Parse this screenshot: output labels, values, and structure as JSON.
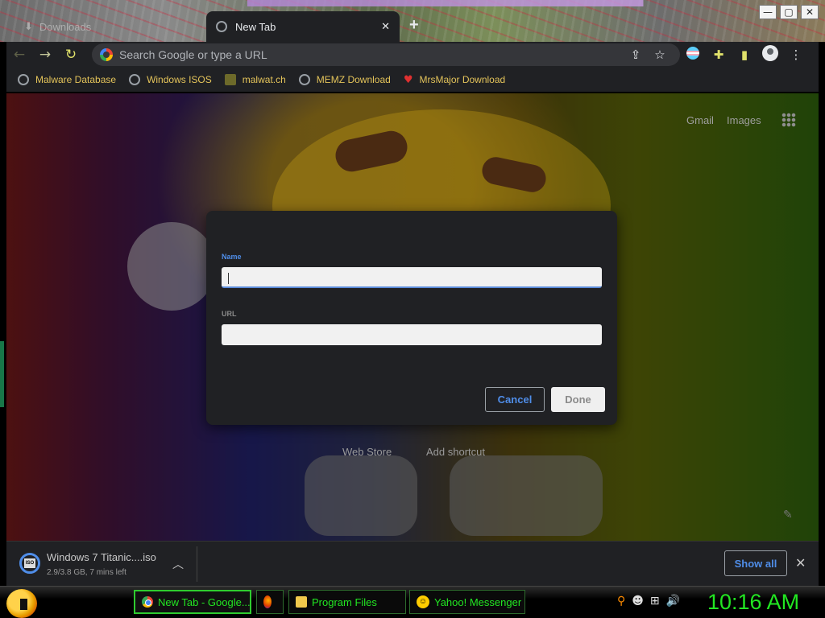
{
  "window": {
    "minimize": "—",
    "maximize": "▢",
    "close": "✕"
  },
  "tabs": [
    {
      "label": "Downloads"
    },
    {
      "label": "New Tab"
    }
  ],
  "toolbar": {
    "omnibox_placeholder": "Search Google or type a URL"
  },
  "bookmarks": [
    {
      "label": "Malware Database",
      "icon": "globe-icon"
    },
    {
      "label": "Windows ISOS",
      "icon": "globe-icon"
    },
    {
      "label": "malwat.ch",
      "icon": "malwatch-icon"
    },
    {
      "label": "MEMZ Download",
      "icon": "globe-icon"
    },
    {
      "label": "MrsMajor Download",
      "icon": "heart-icon"
    }
  ],
  "ntp": {
    "gmail": "Gmail",
    "images": "Images",
    "shortcuts": [
      {
        "label": "Web Store"
      },
      {
        "label": "Add shortcut"
      }
    ]
  },
  "dialog": {
    "name_label": "Name",
    "name_value": "",
    "url_label": "URL",
    "url_value": "",
    "cancel": "Cancel",
    "done": "Done"
  },
  "downloads": {
    "filename": "Windows 7 Titanic....iso",
    "status": "2.9/3.8 GB, 7 mins left",
    "show_all": "Show all",
    "badge": "ISO"
  },
  "taskbar": {
    "items": [
      {
        "label": "New Tab - Google..."
      },
      {
        "label": ""
      },
      {
        "label": "Program Files"
      },
      {
        "label": "Yahoo! Messenger"
      }
    ],
    "clock": "10:16 AM"
  },
  "colors": {
    "accent_blue": "#4f8de8",
    "taskbar_green": "#22e622",
    "bookmark_gold": "#e3c35a"
  }
}
